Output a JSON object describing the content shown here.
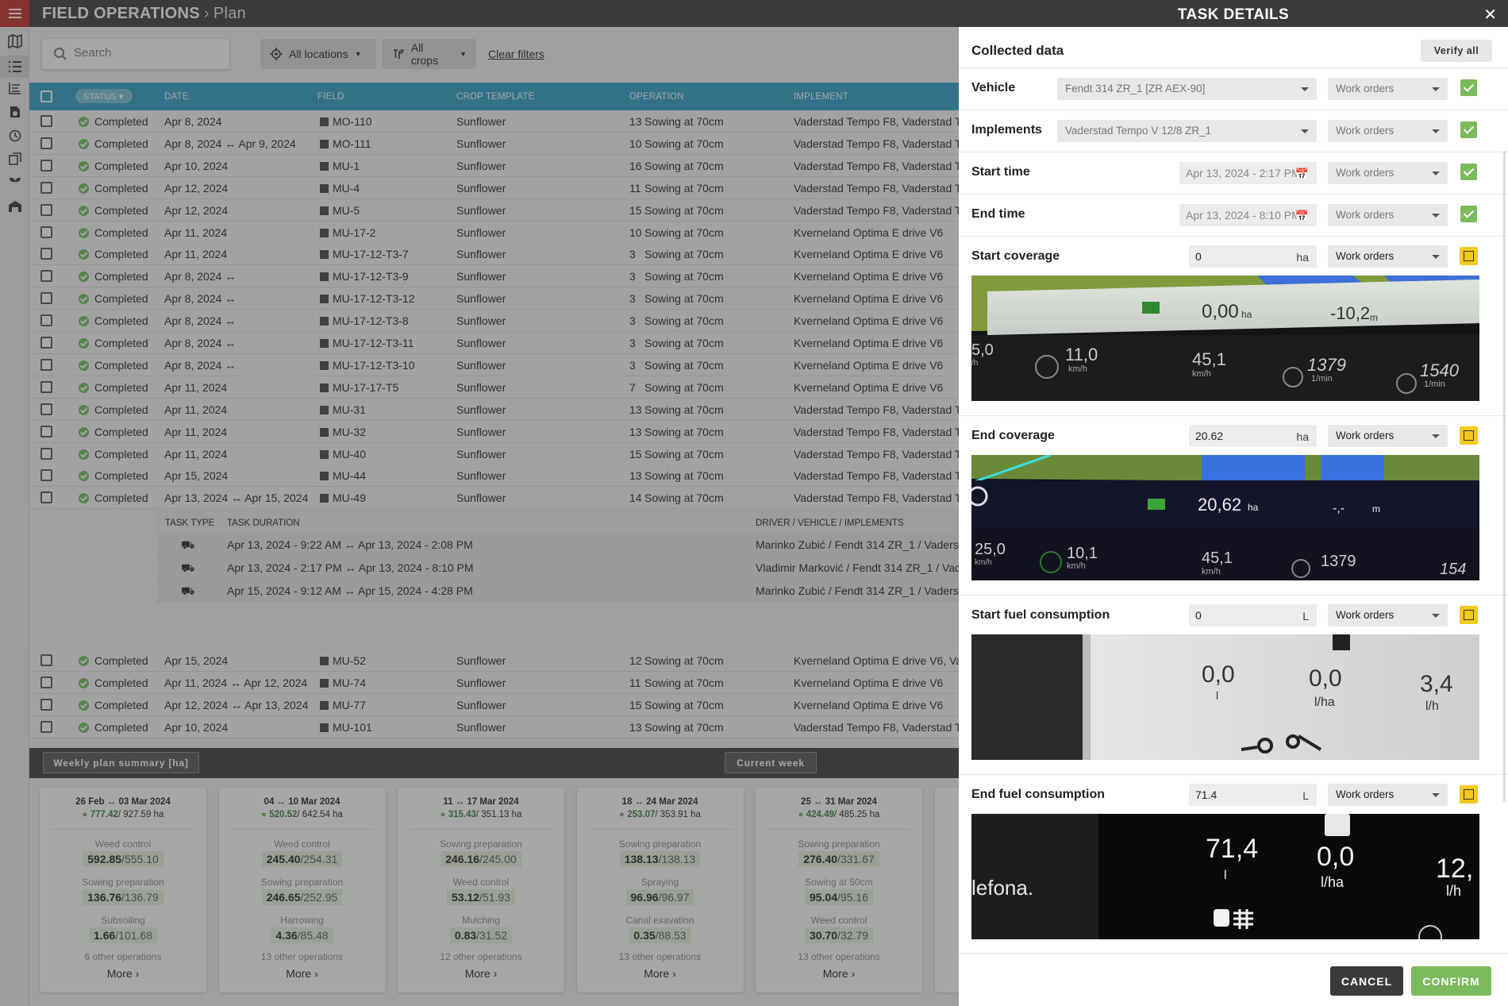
{
  "app": {
    "section": "FIELD OPERATIONS",
    "page": "Plan",
    "colors": {
      "topbar": "#3b3b3b",
      "menu": "#c62828",
      "table_header": "#2b9fc6",
      "accent_green": "#7cba5e",
      "pending_yellow": "#f4c81f"
    }
  },
  "rail": [
    "map-icon",
    "list-icon",
    "plan-icon",
    "report-icon",
    "clock-icon",
    "copy-icon",
    "plant-icon",
    "warehouse-icon"
  ],
  "filters": {
    "search_placeholder": "Search",
    "locations": "All locations",
    "crops": "All crops",
    "clear": "Clear filters"
  },
  "table": {
    "headers": {
      "status": "STATUS",
      "date": "DATE",
      "field": "FIELD",
      "crop": "CROP TEMPLATE",
      "operation": "OPERATION",
      "implement": "IMPLEMENT"
    },
    "rows": [
      {
        "status": "Completed",
        "date": "Apr 8, 2024",
        "field": "MO-110",
        "crop": "Sunflower",
        "num": "13",
        "op": "Sowing at 70cm",
        "impl": "Vaderstad Tempo F8, Vaderstad T"
      },
      {
        "status": "Completed",
        "date": "Apr 8, 2024 ↔ Apr 9, 2024",
        "field": "MO-111",
        "crop": "Sunflower",
        "num": "10",
        "op": "Sowing at 70cm",
        "impl": "Vaderstad Tempo F8, Vaderstad T"
      },
      {
        "status": "Completed",
        "date": "Apr 10, 2024",
        "field": "MU-1",
        "crop": "Sunflower",
        "num": "16",
        "op": "Sowing at 70cm",
        "impl": "Vaderstad Tempo F8, Vaderstad T"
      },
      {
        "status": "Completed",
        "date": "Apr 12, 2024",
        "field": "MU-4",
        "crop": "Sunflower",
        "num": "11",
        "op": "Sowing at 70cm",
        "impl": "Vaderstad Tempo F8, Vaderstad T"
      },
      {
        "status": "Completed",
        "date": "Apr 12, 2024",
        "field": "MU-5",
        "crop": "Sunflower",
        "num": "15",
        "op": "Sowing at 70cm",
        "impl": "Vaderstad Tempo F8, Vaderstad T"
      },
      {
        "status": "Completed",
        "date": "Apr 11, 2024",
        "field": "MU-17-2",
        "crop": "Sunflower",
        "num": "10",
        "op": "Sowing at 70cm",
        "impl": "Kverneland Optima E drive V6"
      },
      {
        "status": "Completed",
        "date": "Apr 11, 2024",
        "field": "MU-17-12-T3-7",
        "crop": "Sunflower",
        "num": "3",
        "op": "Sowing at 70cm",
        "impl": "Kverneland Optima E drive V6"
      },
      {
        "status": "Completed",
        "date": "Apr 8, 2024 ↔",
        "field": "MU-17-12-T3-9",
        "crop": "Sunflower",
        "num": "3",
        "op": "Sowing at 70cm",
        "impl": "Kverneland Optima E drive V6"
      },
      {
        "status": "Completed",
        "date": "Apr 8, 2024 ↔",
        "field": "MU-17-12-T3-12",
        "crop": "Sunflower",
        "num": "3",
        "op": "Sowing at 70cm",
        "impl": "Kverneland Optima E drive V6"
      },
      {
        "status": "Completed",
        "date": "Apr 8, 2024 ↔",
        "field": "MU-17-12-T3-8",
        "crop": "Sunflower",
        "num": "3",
        "op": "Sowing at 70cm",
        "impl": "Kverneland Optima E drive V6"
      },
      {
        "status": "Completed",
        "date": "Apr 8, 2024 ↔",
        "field": "MU-17-12-T3-11",
        "crop": "Sunflower",
        "num": "3",
        "op": "Sowing at 70cm",
        "impl": "Kverneland Optima E drive V6"
      },
      {
        "status": "Completed",
        "date": "Apr 8, 2024 ↔",
        "field": "MU-17-12-T3-10",
        "crop": "Sunflower",
        "num": "3",
        "op": "Sowing at 70cm",
        "impl": "Kverneland Optima E drive V6"
      },
      {
        "status": "Completed",
        "date": "Apr 11, 2024",
        "field": "MU-17-17-T5",
        "crop": "Sunflower",
        "num": "7",
        "op": "Sowing at 70cm",
        "impl": "Kverneland Optima E drive V6"
      },
      {
        "status": "Completed",
        "date": "Apr 11, 2024",
        "field": "MU-31",
        "crop": "Sunflower",
        "num": "13",
        "op": "Sowing at 70cm",
        "impl": "Vaderstad Tempo F8, Vaderstad T"
      },
      {
        "status": "Completed",
        "date": "Apr 11, 2024",
        "field": "MU-32",
        "crop": "Sunflower",
        "num": "13",
        "op": "Sowing at 70cm",
        "impl": "Vaderstad Tempo F8, Vaderstad T"
      },
      {
        "status": "Completed",
        "date": "Apr 11, 2024",
        "field": "MU-40",
        "crop": "Sunflower",
        "num": "15",
        "op": "Sowing at 70cm",
        "impl": "Vaderstad Tempo F8, Vaderstad T"
      },
      {
        "status": "Completed",
        "date": "Apr 15, 2024",
        "field": "MU-44",
        "crop": "Sunflower",
        "num": "13",
        "op": "Sowing at 70cm",
        "impl": "Vaderstad Tempo F8, Vaderstad T"
      },
      {
        "status": "Completed",
        "date": "Apr 13, 2024 ↔ Apr 15, 2024",
        "field": "MU-49",
        "crop": "Sunflower",
        "num": "14",
        "op": "Sowing at 70cm",
        "impl": "Vaderstad Tempo F8, Vaderstad T"
      }
    ],
    "subtable": {
      "headers": {
        "type": "TASK TYPE",
        "duration": "TASK DURATION",
        "driver": "DRIVER / VEHICLE / IMPLEMENTS"
      },
      "rows": [
        {
          "duration": "Apr 13, 2024 - 9:22 AM ↔ Apr 13, 2024 - 2:08 PM",
          "driver": "Marinko Zubić / Fendt 314 ZR_1 / Vaderst"
        },
        {
          "duration": "Apr 13, 2024 - 2:17 PM ↔ Apr 13, 2024 - 8:10 PM",
          "driver": "Vladimir Marković / Fendt 314 ZR_1 / Vad"
        },
        {
          "duration": "Apr 15, 2024 - 9:12 AM ↔ Apr 15, 2024 - 4:28 PM",
          "driver": "Marinko Zubić / Fendt 314 ZR_1 / Vaderst"
        }
      ]
    },
    "rows_after": [
      {
        "status": "Completed",
        "date": "Apr 15, 2024",
        "field": "MU-52",
        "crop": "Sunflower",
        "num": "12",
        "op": "Sowing at 70cm",
        "impl": "Kverneland Optima E drive V6, Vad"
      },
      {
        "status": "Completed",
        "date": "Apr 11, 2024 ↔ Apr 12, 2024",
        "field": "MU-74",
        "crop": "Sunflower",
        "num": "11",
        "op": "Sowing at 70cm",
        "impl": "Kverneland Optima E drive V6"
      },
      {
        "status": "Completed",
        "date": "Apr 12, 2024 ↔ Apr 13, 2024",
        "field": "MU-77",
        "crop": "Sunflower",
        "num": "15",
        "op": "Sowing at 70cm",
        "impl": "Kverneland Optima E drive V6"
      },
      {
        "status": "Completed",
        "date": "Apr 10, 2024",
        "field": "MU-101",
        "crop": "Sunflower",
        "num": "13",
        "op": "Sowing at 70cm",
        "impl": "Vaderstad Tempo F8, Vaderstad T"
      }
    ]
  },
  "summary": {
    "title": "Weekly plan summary [ha]",
    "current_week": "Current week",
    "more": "More",
    "weeks": [
      {
        "range": "26 Feb ↔ 03 Mar 2024",
        "done": "777.42",
        "total": "/ 927.59 ha",
        "ops": [
          {
            "name": "Weed control",
            "done": "592.85",
            "total": "/555.10"
          },
          {
            "name": "Sowing preparation",
            "done": "136.76",
            "total": "/136.79"
          },
          {
            "name": "Subsoiling",
            "done": "1.66",
            "total": "/101.68"
          }
        ],
        "other": "6 other operations"
      },
      {
        "range": "04 ↔ 10 Mar 2024",
        "done": "520.52",
        "total": "/ 642.54 ha",
        "ops": [
          {
            "name": "Weed control",
            "done": "245.40",
            "total": "/254.31"
          },
          {
            "name": "Sowing preparation",
            "done": "246.65",
            "total": "/252.95"
          },
          {
            "name": "Harrowing",
            "done": "4.36",
            "total": "/85.48"
          }
        ],
        "other": "13 other operations"
      },
      {
        "range": "11 ↔ 17 Mar 2024",
        "done": "315.43",
        "total": "/ 351.13 ha",
        "ops": [
          {
            "name": "Sowing preparation",
            "done": "246.16",
            "total": "/245.00"
          },
          {
            "name": "Weed control",
            "done": "53.12",
            "total": "/51.93"
          },
          {
            "name": "Mulching",
            "done": "0.83",
            "total": "/31.52"
          }
        ],
        "other": "12 other operations"
      },
      {
        "range": "18 ↔ 24 Mar 2024",
        "done": "253.07",
        "total": "/ 353.91 ha",
        "ops": [
          {
            "name": "Sowing preparation",
            "done": "138.13",
            "total": "/138.13"
          },
          {
            "name": "Spraying",
            "done": "96.96",
            "total": "/96.97"
          },
          {
            "name": "Canal exavation",
            "done": "0.35",
            "total": "/88.53"
          }
        ],
        "other": "13 other operations"
      },
      {
        "range": "25 ↔ 31 Mar 2024",
        "done": "424.49",
        "total": "/ 485.25 ha",
        "ops": [
          {
            "name": "Sowing preparation",
            "done": "276.40",
            "total": "/331.67"
          },
          {
            "name": "Sowing at 50cm",
            "done": "95.04",
            "total": "/95.16"
          },
          {
            "name": "Weed control",
            "done": "30.70",
            "total": "/32.79"
          }
        ],
        "other": "13 other operations"
      }
    ]
  },
  "panel": {
    "title": "TASK DETAILS",
    "collected": "Collected data",
    "verify_all": "Verify all",
    "source": "Work orders",
    "vehicle": {
      "label": "Vehicle",
      "value": "Fendt 314 ZR_1 [ZR AEX-90]"
    },
    "implements": {
      "label": "Implements",
      "value": "Vaderstad Tempo V 12/8 ZR_1"
    },
    "start_time": {
      "label": "Start time",
      "value": "Apr 13, 2024 - 2:17 PM"
    },
    "end_time": {
      "label": "End time",
      "value": "Apr 13, 2024 - 8:10 PM"
    },
    "start_coverage": {
      "label": "Start coverage",
      "value": "0",
      "unit": "ha",
      "photo": {
        "area": "0,00",
        "area_unit": "ha",
        "dist": "-10,2",
        "dist_unit": "m",
        "left": "5,0",
        "left_unit": "/h",
        "speed": "11,0",
        "speed_unit": "km/h",
        "g2": "45,1",
        "g2_unit": "km/h",
        "rpm": "1379",
        "rpm_unit": "1/min",
        "rpm2": "1540",
        "rpm2_unit": "1/min"
      }
    },
    "end_coverage": {
      "label": "End coverage",
      "value": "20.62",
      "unit": "ha",
      "photo": {
        "area": "20,62",
        "area_unit": "ha",
        "dist": "-,-",
        "dist_unit": "m",
        "left": "25,0",
        "left_unit": "km/h",
        "speed": "10,1",
        "speed_unit": "km/h",
        "g2": "45,1",
        "g2_unit": "km/h",
        "rpm": "1379",
        "rpm_unit": "1/min",
        "rpm2": "154"
      }
    },
    "start_fuel": {
      "label": "Start fuel consumption",
      "value": "0",
      "unit": "L",
      "photo": {
        "a": "0,0",
        "a_unit": "l",
        "b": "0,0",
        "b_unit": "l/ha",
        "c": "3,4",
        "c_unit": "l/h"
      }
    },
    "end_fuel": {
      "label": "End fuel consumption",
      "value": "71.4",
      "unit": "L",
      "photo": {
        "a": "71,4",
        "a_unit": "l",
        "b": "0,0",
        "b_unit": "l/ha",
        "c": "12,",
        "c_unit": "l/h",
        "brand": "lefona."
      }
    },
    "cancel": "CANCEL",
    "confirm": "CONFIRM"
  }
}
